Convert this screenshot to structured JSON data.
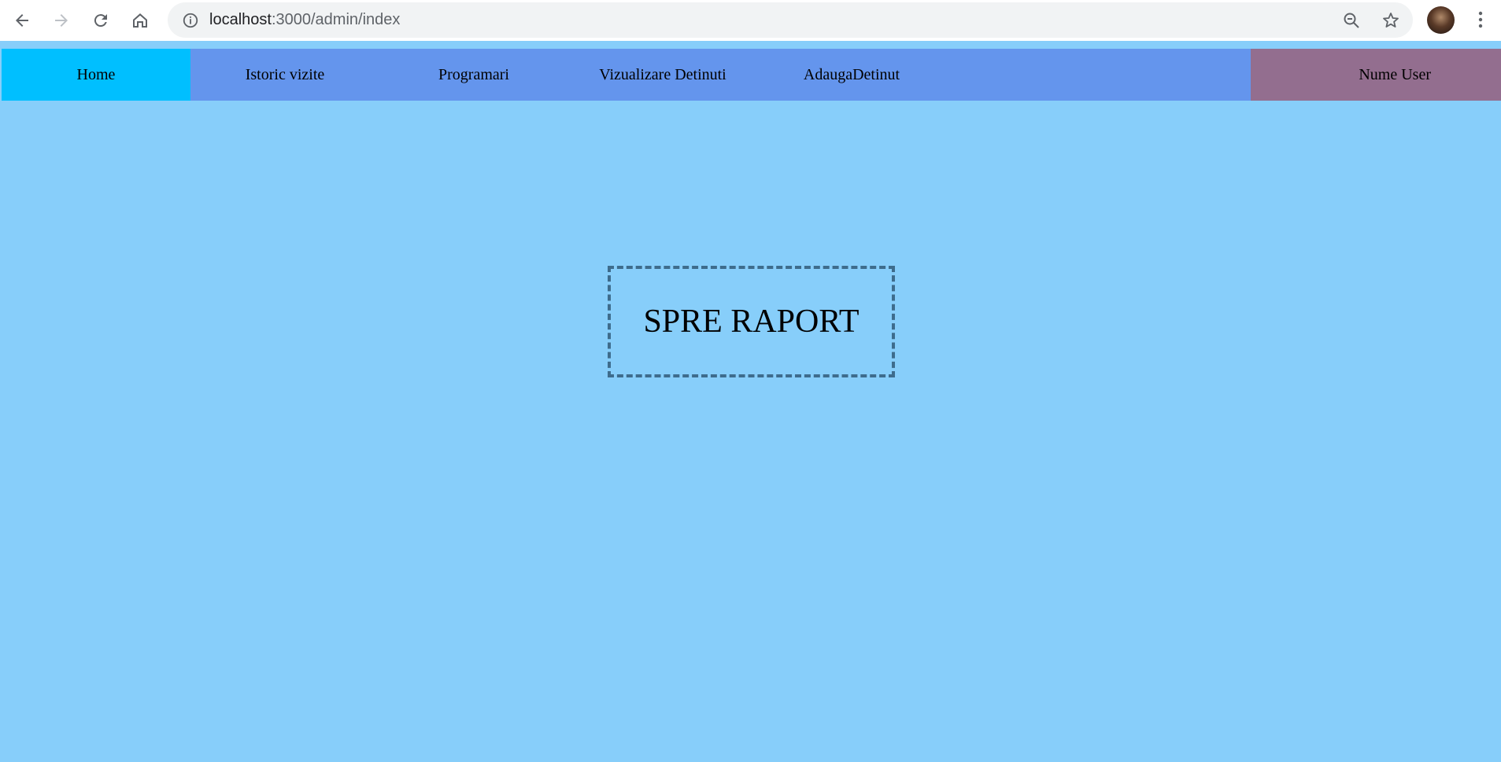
{
  "browser": {
    "url_host": "localhost",
    "url_path": ":3000/admin/index",
    "icons": [
      "back-arrow-icon",
      "forward-arrow-icon",
      "reload-icon",
      "home-icon",
      "info-icon",
      "zoom-out-icon",
      "star-icon",
      "avatar",
      "kebab-menu-icon"
    ]
  },
  "nav": {
    "items": [
      {
        "label": "Home",
        "active": true
      },
      {
        "label": "Istoric vizite"
      },
      {
        "label": "Programari"
      },
      {
        "label": "Vizualizare Detinuti"
      },
      {
        "label": "AdaugaDetinut"
      }
    ],
    "user_label": "Nume User"
  },
  "main": {
    "report_label": "SPRE RAPORT"
  },
  "colors": {
    "page_bg": "#87cefa",
    "nav_bg": "#6495ed",
    "nav_active": "#00bfff",
    "user_bg": "#936e8f",
    "box_border": "#3e6c8c"
  }
}
